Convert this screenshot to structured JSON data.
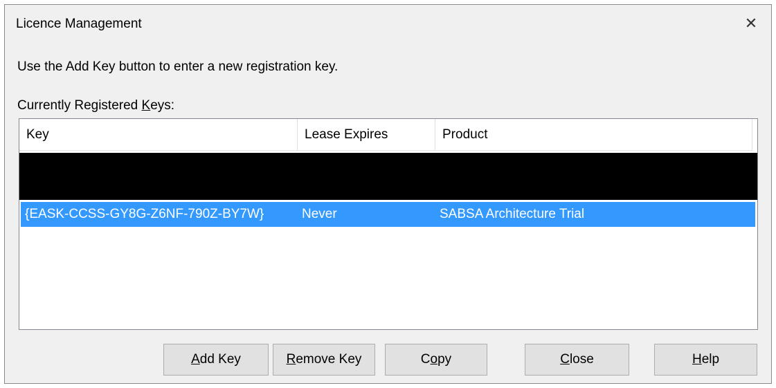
{
  "window": {
    "title": "Licence Management",
    "close_glyph": "✕"
  },
  "instruction": "Use the Add Key button to enter a new registration key.",
  "list_label": {
    "before": "Currently Registered ",
    "mnemonic": "K",
    "after": "eys:"
  },
  "table": {
    "columns": [
      "Key",
      "Lease Expires",
      "Product"
    ],
    "rows": [
      {
        "key": "{EASK-CCSS-GY8G-Z6NF-790Z-BY7W}",
        "lease_expires": "Never",
        "product": "SABSA Architecture Trial",
        "selected": true
      }
    ]
  },
  "buttons": {
    "add_key": {
      "mnemonic": "A",
      "rest": "dd Key"
    },
    "remove_key": {
      "mnemonic": "R",
      "rest": "emove Key"
    },
    "copy": {
      "before": "C",
      "mnemonic": "o",
      "rest": "py"
    },
    "close": {
      "mnemonic": "C",
      "rest": "lose"
    },
    "help": {
      "mnemonic": "H",
      "rest": "elp"
    }
  },
  "colors": {
    "dialog_bg": "#f0f0f0",
    "selection": "#3399ff",
    "redaction": "#000000"
  }
}
